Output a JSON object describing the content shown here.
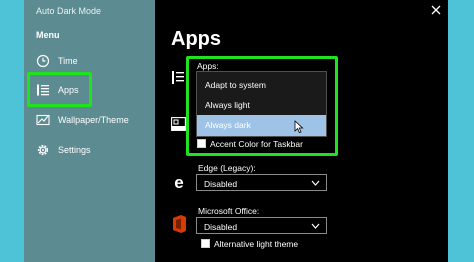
{
  "window": {
    "title": "Auto Dark Mode"
  },
  "sidebar": {
    "menu_label": "Menu",
    "items": [
      {
        "label": "Time",
        "icon": "clock-icon"
      },
      {
        "label": "Apps",
        "icon": "list-icon"
      },
      {
        "label": "Wallpaper/Theme",
        "icon": "wallpaper-icon"
      },
      {
        "label": "Settings",
        "icon": "gear-icon"
      }
    ]
  },
  "main": {
    "title": "Apps",
    "apps_dropdown": {
      "label": "Apps:",
      "options": [
        "Adapt to system",
        "Always light",
        "Always dark"
      ],
      "selected": "Always dark"
    },
    "accent_color_label": "Accent Color for Taskbar",
    "edge": {
      "label": "Edge (Legacy):",
      "value": "Disabled"
    },
    "office": {
      "label": "Microsoft Office:",
      "value": "Disabled",
      "checkbox_label": "Alternative light theme"
    }
  },
  "colors": {
    "highlight": "#1fe31f",
    "sidebar": "#5d8b92",
    "selection": "#9ec3e6",
    "background": "#4ec3d8"
  }
}
